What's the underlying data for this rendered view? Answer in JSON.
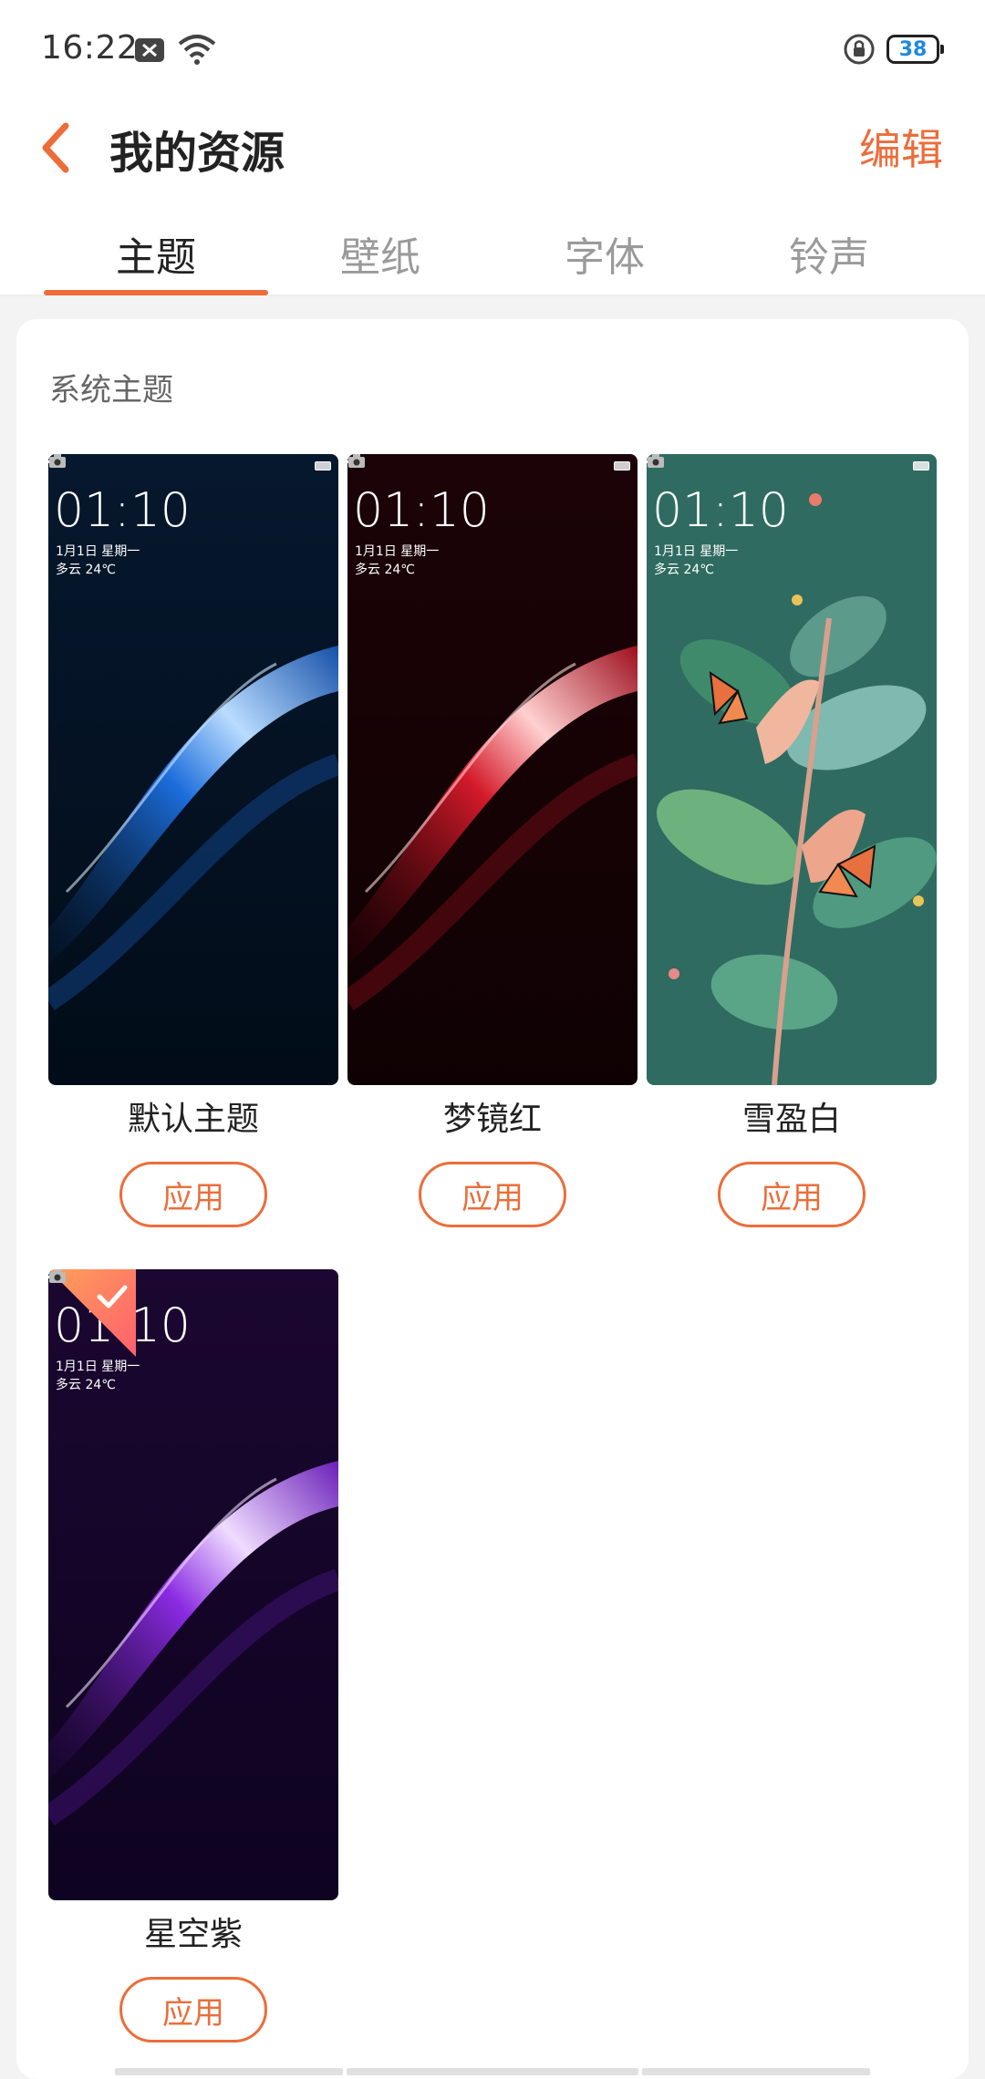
{
  "status_bar": {
    "time": "16:22",
    "battery": "38",
    "icons": [
      "notification-x-icon",
      "wifi-icon",
      "screen-lock-icon",
      "battery-icon"
    ]
  },
  "header": {
    "title": "我的资源",
    "edit_label": "编辑",
    "back_icon": "chevron-left-icon"
  },
  "tabs": [
    {
      "label": "主题",
      "active": true
    },
    {
      "label": "壁纸",
      "active": false
    },
    {
      "label": "字体",
      "active": false
    },
    {
      "label": "铃声",
      "active": false
    }
  ],
  "section": {
    "title": "系统主题"
  },
  "themes": [
    {
      "name": "默认主题",
      "apply_label": "应用",
      "clock": "01:10",
      "date": "1月1日 星期一",
      "weather": "多云 24℃",
      "selected": false,
      "colors": {
        "bg": "#041326",
        "accent": "#1e6fd9"
      }
    },
    {
      "name": "梦镜红",
      "apply_label": "应用",
      "clock": "01:10",
      "date": "1月1日 星期一",
      "weather": "多云 24℃",
      "selected": false,
      "colors": {
        "bg": "#1a0205",
        "accent": "#d8192c"
      }
    },
    {
      "name": "雪盈白",
      "apply_label": "应用",
      "clock": "01:10",
      "date": "1月1日 星期一",
      "weather": "多云 24℃",
      "selected": false,
      "colors": {
        "bg": "#2f6b60",
        "accent": "#e6835d"
      }
    },
    {
      "name": "星空紫",
      "apply_label": "应用",
      "clock": "01:10",
      "date": "1月1日 星期一",
      "weather": "多云 24℃",
      "selected": true,
      "colors": {
        "bg": "#1a0630",
        "accent": "#8a2be2"
      }
    }
  ],
  "colors": {
    "accent": "#ec6d3a",
    "selected_corner": "#ff7b45"
  }
}
